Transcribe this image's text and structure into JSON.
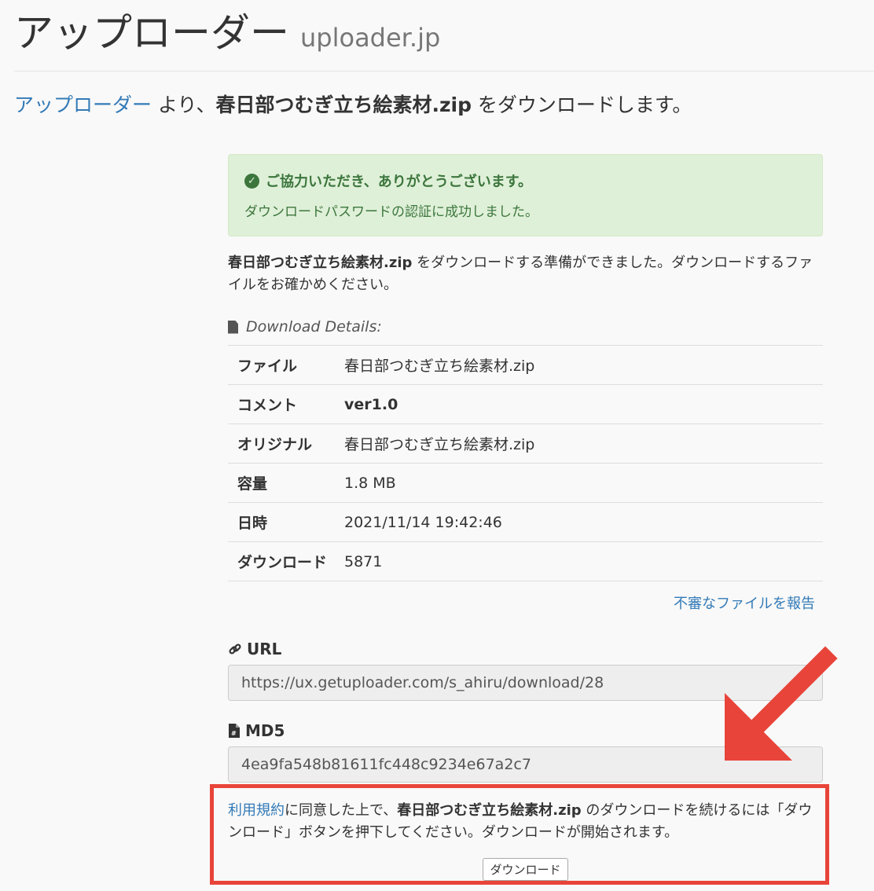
{
  "header": {
    "title": "アップローダー",
    "subtitle": "uploader.jp"
  },
  "lead": {
    "link": "アップローダー",
    "from": " より、",
    "filename": "春日部つむぎ立ち絵素材.zip",
    "suffix": " をダウンロードします。"
  },
  "alert": {
    "title": "ご協力いただき、ありがとうございます。",
    "message": "ダウンロードパスワードの認証に成功しました。"
  },
  "ready": {
    "filename": "春日部つむぎ立ち絵素材.zip",
    "text": " をダウンロードする準備ができました。ダウンロードするファイルをお確かめください。"
  },
  "details": {
    "heading": "Download Details:",
    "rows": [
      {
        "label": "ファイル",
        "value": "春日部つむぎ立ち絵素材.zip"
      },
      {
        "label": "コメント",
        "value": "ver1.0"
      },
      {
        "label": "オリジナル",
        "value": "春日部つむぎ立ち絵素材.zip"
      },
      {
        "label": "容量",
        "value": "1.8 MB"
      },
      {
        "label": "日時",
        "value": "2021/11/14 19:42:46"
      },
      {
        "label": "ダウンロード",
        "value": "5871"
      }
    ]
  },
  "report_link": "不審なファイルを報告",
  "url": {
    "label": "URL",
    "value": "https://ux.getuploader.com/s_ahiru/download/28"
  },
  "md5": {
    "label": "MD5",
    "value": "4ea9fa548b81611fc448c9234e67a2c7"
  },
  "agree": {
    "terms_link": "利用規約",
    "text1": "に同意した上で、",
    "filename": "春日部つむぎ立ち絵素材.zip",
    "text2": " のダウンロードを続けるには「ダウンロード」ボタンを押下してください。ダウンロードが開始されます。"
  },
  "download_button": "ダウンロード",
  "icons": {
    "success": "check-circle-icon",
    "details": "file-icon",
    "url": "link-icon",
    "md5": "file-hash-icon"
  },
  "colors": {
    "link": "#337ab7",
    "alert_bg": "#dff0d8",
    "alert_text": "#3c763d",
    "highlight": "#e8443a"
  }
}
